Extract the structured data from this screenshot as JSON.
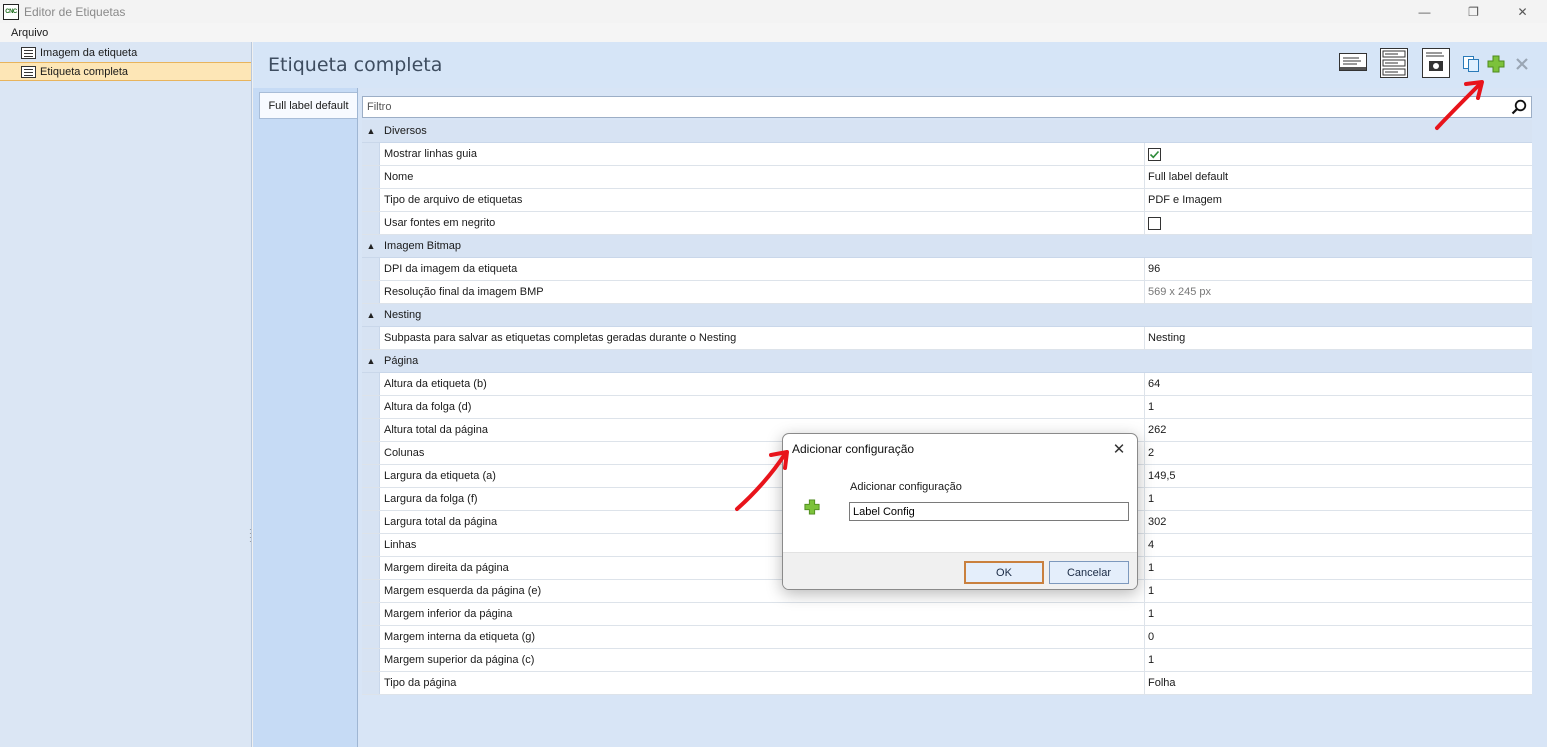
{
  "window": {
    "title": "Editor de Etiquetas",
    "app_icon_text": "CNC",
    "controls": [
      "—",
      "❐",
      "✕"
    ]
  },
  "menu": {
    "items": [
      "Arquivo"
    ]
  },
  "tree": {
    "items": [
      {
        "label": "Imagem da etiqueta",
        "selected": false
      },
      {
        "label": "Etiqueta completa",
        "selected": true
      }
    ]
  },
  "panel": {
    "title": "Etiqueta completa",
    "toolbar_icons": [
      "label-layout-icon",
      "label-page-icon",
      "label-image-icon",
      "copy-icon",
      "add-icon",
      "delete-icon"
    ],
    "tabs": [
      "Full label default"
    ]
  },
  "filter": {
    "placeholder": "Filtro",
    "value": ""
  },
  "grid": {
    "categories": [
      {
        "name": "Diversos",
        "rows": [
          {
            "name": "Mostrar linhas guia",
            "value": "",
            "checkbox": true,
            "checked": true
          },
          {
            "name": "Nome",
            "value": "Full label default"
          },
          {
            "name": "Tipo de arquivo de etiquetas",
            "value": "PDF e Imagem"
          },
          {
            "name": "Usar fontes em negrito",
            "value": "",
            "checkbox": true,
            "checked": false
          }
        ]
      },
      {
        "name": "Imagem Bitmap",
        "rows": [
          {
            "name": "DPI da imagem da etiqueta",
            "value": "96"
          },
          {
            "name": "Resolução final da imagem BMP",
            "value": "569 x 245 px",
            "readonly": true
          }
        ]
      },
      {
        "name": "Nesting",
        "rows": [
          {
            "name": "Subpasta para salvar as etiquetas completas geradas durante o Nesting",
            "value": "Nesting"
          }
        ]
      },
      {
        "name": "Página",
        "rows": [
          {
            "name": "Altura da etiqueta (b)",
            "value": "64"
          },
          {
            "name": "Altura da folga (d)",
            "value": "1"
          },
          {
            "name": "Altura total da página",
            "value": "262"
          },
          {
            "name": "Colunas",
            "value": "2"
          },
          {
            "name": "Largura da etiqueta (a)",
            "value": "149,5"
          },
          {
            "name": "Largura da folga (f)",
            "value": "1"
          },
          {
            "name": "Largura total da página",
            "value": "302"
          },
          {
            "name": "Linhas",
            "value": "4"
          },
          {
            "name": "Margem direita da página",
            "value": "1"
          },
          {
            "name": "Margem esquerda da página (e)",
            "value": "1"
          },
          {
            "name": "Margem inferior da página",
            "value": "1"
          },
          {
            "name": "Margem interna da etiqueta (g)",
            "value": "0"
          },
          {
            "name": "Margem superior da página (c)",
            "value": "1"
          },
          {
            "name": "Tipo da página",
            "value": "Folha"
          }
        ]
      }
    ]
  },
  "dialog": {
    "title": "Adicionar configuração",
    "label": "Adicionar configuração",
    "input_value": "Label Config",
    "ok_label": "OK",
    "cancel_label": "Cancelar",
    "close_glyph": "✕"
  },
  "colors": {
    "tree_bg": "#dbe6f4",
    "panel_bg": "#c6dbf5",
    "selected_bg": "#fde6b6",
    "annotation_red": "#e8141b",
    "add_green": "#7cc23b"
  }
}
